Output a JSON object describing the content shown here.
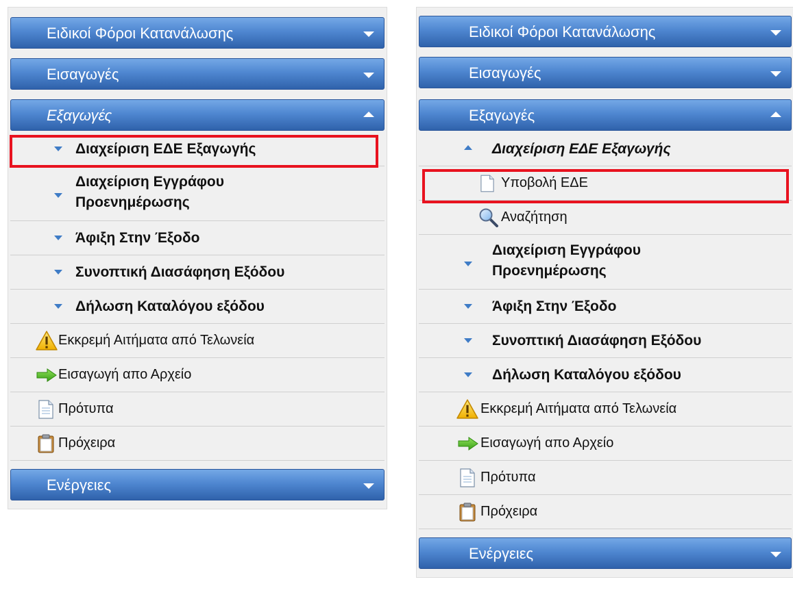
{
  "left": {
    "headers": {
      "excise": "Ειδικοί Φόροι Κατανάλωσης",
      "imports": "Εισαγωγές",
      "exports": "Εξαγωγές",
      "actions": "Ενέργειες"
    },
    "items": {
      "manage_ede": "Διαχείριση ΕΔΕ Εξαγωγής",
      "doc_line1": "Διαχείριση Εγγράφου",
      "doc_line2": "Προενημέρωσης",
      "arrival": "Άφιξη Στην Έξοδο",
      "summary": "Συνοπτική Διασάφηση Εξόδου",
      "catalog": "Δήλωση Καταλόγου εξόδου",
      "pending": "Εκκρεμή Αιτήματα από Τελωνεία",
      "import_file": "Εισαγωγή απο Αρχείο",
      "templates": "Πρότυπα",
      "drafts": "Πρόχειρα"
    }
  },
  "right": {
    "headers": {
      "excise": "Ειδικοί Φόροι Κατανάλωσης",
      "imports": "Εισαγωγές",
      "exports": "Εξαγωγές",
      "actions": "Ενέργειες"
    },
    "items": {
      "manage_ede": "Διαχείριση ΕΔΕ Εξαγωγής",
      "submit_ede": "Υποβολή ΕΔΕ",
      "search": "Αναζήτηση",
      "doc_line1": "Διαχείριση Εγγράφου",
      "doc_line2": "Προενημέρωσης",
      "arrival": "Άφιξη Στην Έξοδο",
      "summary": "Συνοπτική Διασάφηση Εξόδου",
      "catalog": "Δήλωση Καταλόγου εξόδου",
      "pending": "Εκκρεμή Αιτήματα από Τελωνεία",
      "import_file": "Εισαγωγή απο Αρχείο",
      "templates": "Πρότυπα",
      "drafts": "Πρόχειρα"
    }
  },
  "colors": {
    "header_top": "#74a8e6",
    "header_bottom": "#2f62ab",
    "panel_bg": "#f0f0f0",
    "highlight": "#e8121f",
    "arrow": "#3f7cc6"
  },
  "icons": {
    "expand": "triangle-down-icon",
    "collapse": "triangle-up-icon",
    "warning": "warning-icon",
    "import": "green-arrow-icon",
    "template": "document-icon",
    "draft": "clipboard-icon",
    "search": "magnifier-icon"
  }
}
